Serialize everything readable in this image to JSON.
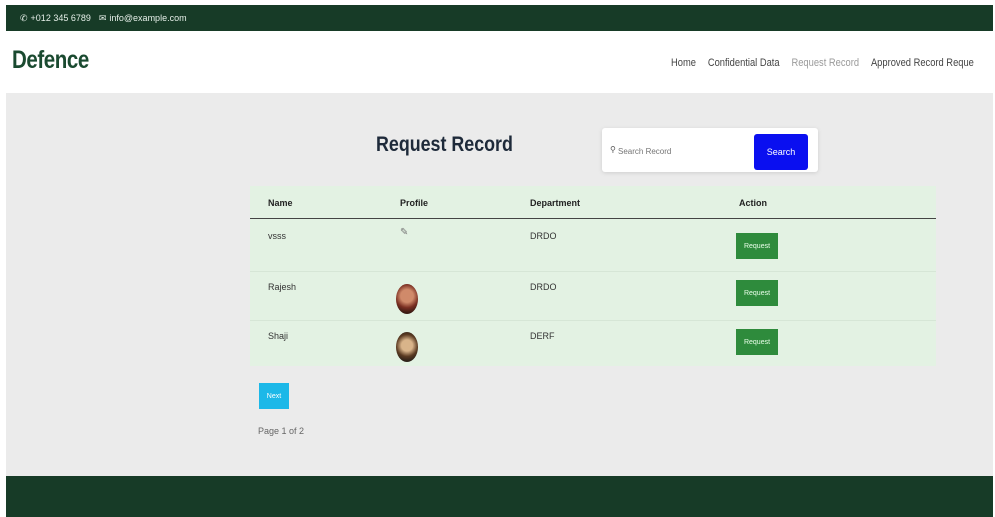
{
  "topbar": {
    "phone": "+012 345 6789",
    "email": "info@example.com",
    "phone_icon": "phone-icon",
    "email_icon": "envelope-icon"
  },
  "navbar": {
    "brand": "Defence",
    "links": [
      "Home",
      "Confidential Data",
      "Request Record",
      "Approved Record Reque"
    ],
    "active_link": "Request Record"
  },
  "main": {
    "title": "Request Record",
    "search": {
      "placeholder": "Search Record",
      "button_label": "Search"
    },
    "table": {
      "columns": [
        "Name",
        "Profile",
        "Department",
        "Action"
      ],
      "rows": [
        {
          "name": "vsss",
          "department": "DRDO",
          "action": "Request",
          "profile": "broken-image-icon"
        },
        {
          "name": "Rajesh",
          "department": "DRDO",
          "action": "Request",
          "profile": "profile-photo"
        },
        {
          "name": "Shaji",
          "department": "DERF",
          "action": "Request",
          "profile": "profile-photo"
        }
      ]
    },
    "pagination": {
      "next_label": "Next",
      "page_info": "Page 1 of 2"
    }
  },
  "colors": {
    "topbar": "#173b27",
    "brand": "#1a4a30",
    "search_button": "#0a0ff0",
    "request_button": "#2e8b3c",
    "next_button": "#1cb8e8",
    "table_bg": "#e3f2e3"
  }
}
